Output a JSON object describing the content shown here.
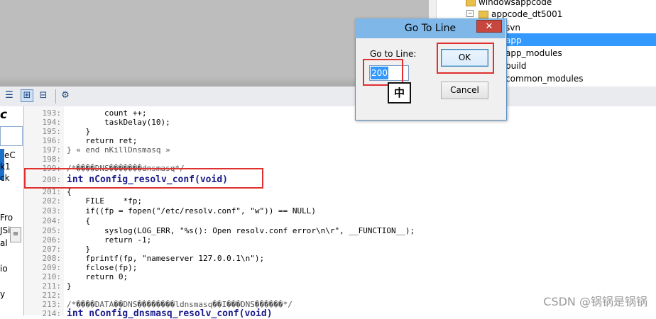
{
  "tree": {
    "items": [
      {
        "label": "windowsappcode"
      },
      {
        "label": "appcode_dt5001"
      },
      {
        "label": "svn"
      },
      {
        "label": "app"
      },
      {
        "label": "app_modules"
      },
      {
        "label": "build"
      },
      {
        "label": "common_modules"
      }
    ]
  },
  "left_panel": {
    "title_char": "c",
    "rows": [
      "eC",
      "k1",
      "ck",
      "Fro",
      "JSi",
      "al",
      "io",
      "y"
    ],
    "scroll_glyph": "≡"
  },
  "code_lines": [
    {
      "num": "193:",
      "text": "        count ++;"
    },
    {
      "num": "194:",
      "text": "        taskDelay(10);"
    },
    {
      "num": "195:",
      "text": "    }"
    },
    {
      "num": "196:",
      "text": "    return ret;"
    },
    {
      "num": "197:",
      "text": "} « end nKillDnsmasq »"
    },
    {
      "num": "198:",
      "text": ""
    },
    {
      "num": "199:",
      "text": "/*����DNS�������dnsmasq*/"
    },
    {
      "num": "200:",
      "text": "int nConfig_resolv_conf(void)"
    },
    {
      "num": "201:",
      "text": "{"
    },
    {
      "num": "202:",
      "text": "    FILE    *fp;"
    },
    {
      "num": "203:",
      "text": "    if((fp = fopen(\"/etc/resolv.conf\", \"w\")) == NULL)"
    },
    {
      "num": "204:",
      "text": "    {"
    },
    {
      "num": "205:",
      "text": "        syslog(LOG_ERR, \"%s(): Open resolv.conf error\\n\\r\", __FUNCTION__);"
    },
    {
      "num": "206:",
      "text": "        return -1;"
    },
    {
      "num": "207:",
      "text": "    }"
    },
    {
      "num": "208:",
      "text": "    fprintf(fp, \"nameserver 127.0.0.1\\n\");"
    },
    {
      "num": "209:",
      "text": "    fclose(fp);"
    },
    {
      "num": "210:",
      "text": "    return 0;"
    },
    {
      "num": "211:",
      "text": "}"
    },
    {
      "num": "212:",
      "text": ""
    },
    {
      "num": "213:",
      "text": "/*����DATA��DNS��������ldnsmasq��I���DNS������*/"
    },
    {
      "num": "214:",
      "text": "int nConfig_dnsmasq_resolv_conf(void)"
    }
  ],
  "dialog": {
    "title": "Go To Line",
    "close_glyph": "✕",
    "label": "Go to Line:",
    "input_value": "200",
    "ok_label": "OK",
    "cancel_label": "Cancel"
  },
  "ime": {
    "char": "中"
  },
  "watermark": "CSDN @锅锅是锅锅",
  "colors": {
    "annotation_red": "#e03030",
    "selection_blue": "#3399ff",
    "title_bar": "#7fb8e8"
  }
}
